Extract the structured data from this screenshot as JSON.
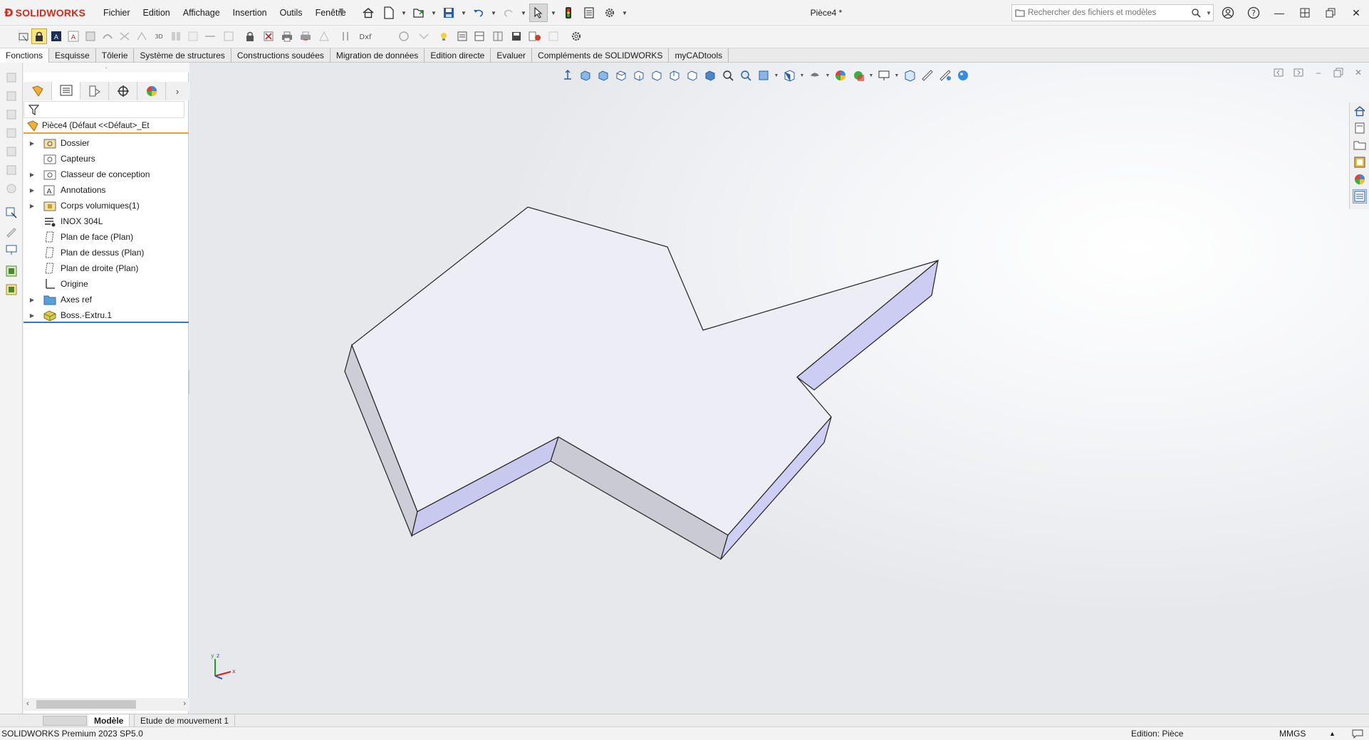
{
  "app": {
    "brand": "SOLIDWORKS",
    "document_title": "Pièce4 *"
  },
  "menu": [
    "Fichier",
    "Edition",
    "Affichage",
    "Insertion",
    "Outils",
    "Fenêtre"
  ],
  "search": {
    "placeholder": "Rechercher des fichiers et modèles"
  },
  "command_tabs": [
    "Fonctions",
    "Esquisse",
    "Tôlerie",
    "Système de structures",
    "Constructions soudées",
    "Migration de données",
    "Edition directe",
    "Evaluer",
    "Compléments de SOLIDWORKS",
    "myCADtools"
  ],
  "feature_tree": {
    "root": "Pièce4  (Défaut <<Défaut>_Et",
    "items": [
      {
        "label": "Dossier",
        "expandable": true,
        "icon": "folder-icon"
      },
      {
        "label": "Capteurs",
        "expandable": false,
        "icon": "sensor-icon"
      },
      {
        "label": "Classeur de conception",
        "expandable": true,
        "icon": "design-binder-icon"
      },
      {
        "label": "Annotations",
        "expandable": true,
        "icon": "annotations-icon"
      },
      {
        "label": "Corps volumiques(1)",
        "expandable": true,
        "icon": "solid-bodies-icon"
      },
      {
        "label": "INOX 304L",
        "expandable": false,
        "icon": "material-icon"
      },
      {
        "label": "Plan de face (Plan)",
        "expandable": false,
        "icon": "plane-icon"
      },
      {
        "label": "Plan de dessus (Plan)",
        "expandable": false,
        "icon": "plane-icon"
      },
      {
        "label": "Plan de droite (Plan)",
        "expandable": false,
        "icon": "plane-icon"
      },
      {
        "label": "Origine",
        "expandable": false,
        "icon": "origin-icon"
      },
      {
        "label": "Axes ref",
        "expandable": true,
        "icon": "folder-icon"
      },
      {
        "label": "Boss.-Extru.1",
        "expandable": true,
        "icon": "extrude-feature-icon"
      }
    ]
  },
  "bottom_tabs": [
    "Modèle",
    "Etude de mouvement 1"
  ],
  "status": {
    "version": "SOLIDWORKS Premium 2023 SP5.0",
    "mode": "Edition: Pièce",
    "units": "MMGS"
  },
  "triad": {
    "x": "x",
    "y": "y",
    "z": "z"
  },
  "colors": {
    "brand_red": "#d52b1e",
    "model_top_face": "#ececf6",
    "model_front_face": "#cbcbd6",
    "model_side_face": "#d0d0f4",
    "selection_underline": "#f0a030",
    "tree_end_marker": "#2a7ac8"
  }
}
